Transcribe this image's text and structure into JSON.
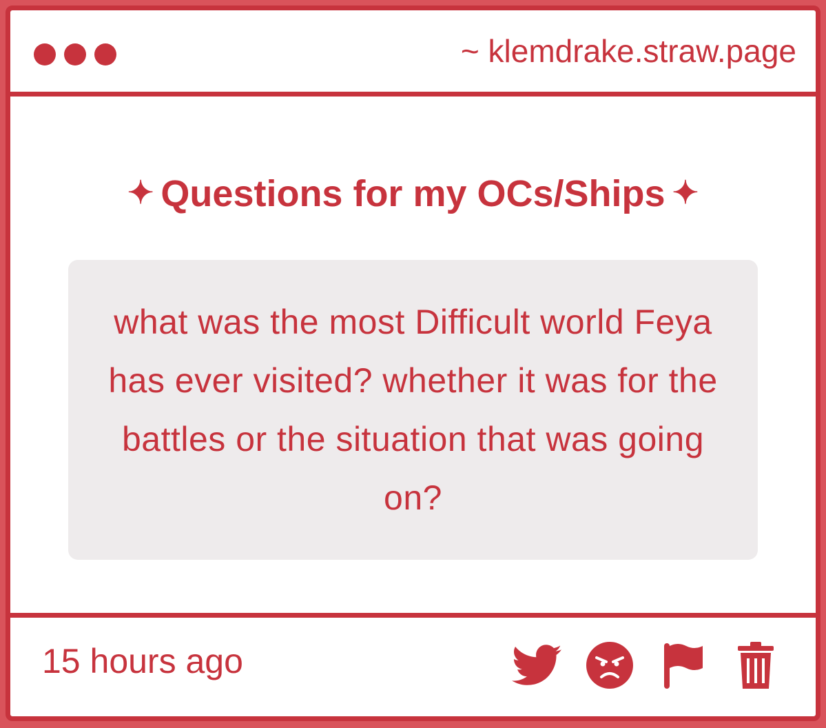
{
  "window": {
    "url": "~ klemdrake.straw.page"
  },
  "main": {
    "heading_prefix": "✦",
    "heading": "Questions for my OCs/Ships",
    "heading_suffix": "✦",
    "question": "what was the most Difficult world Feya has ever visited? whether it was for the battles or the situation that was going on?"
  },
  "footer": {
    "timestamp": "15 hours ago",
    "actions": [
      "twitter-icon",
      "angry-face-icon",
      "flag-icon",
      "trash-icon"
    ]
  },
  "colors": {
    "accent": "#c7333d",
    "background": "#ffffff",
    "question_box": "#eeebec",
    "outer": "#d9535b"
  }
}
